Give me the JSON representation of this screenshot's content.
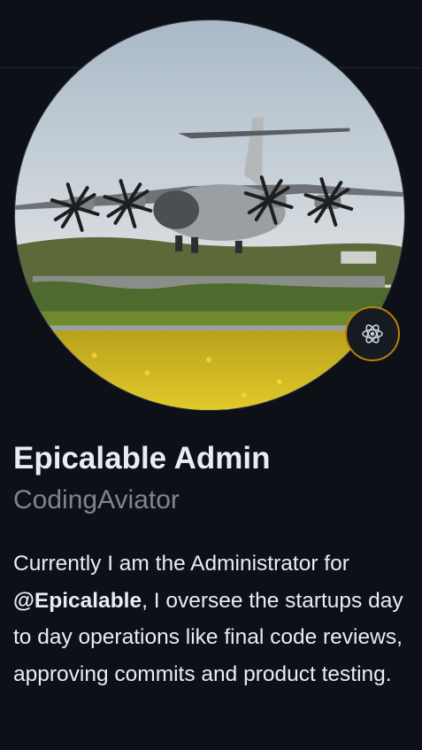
{
  "profile": {
    "name": "Epicalable Admin",
    "username": "CodingAviator",
    "avatar_alt": "A400M aircraft landing over a yellow field",
    "status_icon": "atom-icon",
    "bio": {
      "before": "Currently I am the Administrator for ",
      "mention": "@Epicalable",
      "after": ", I oversee the startups day to day operations like final code reviews, approving commits and product testing."
    }
  },
  "colors": {
    "background": "#0d1117",
    "text_primary": "#e6edf3",
    "text_secondary": "#7d8590",
    "status_ring": "#bb8009"
  }
}
